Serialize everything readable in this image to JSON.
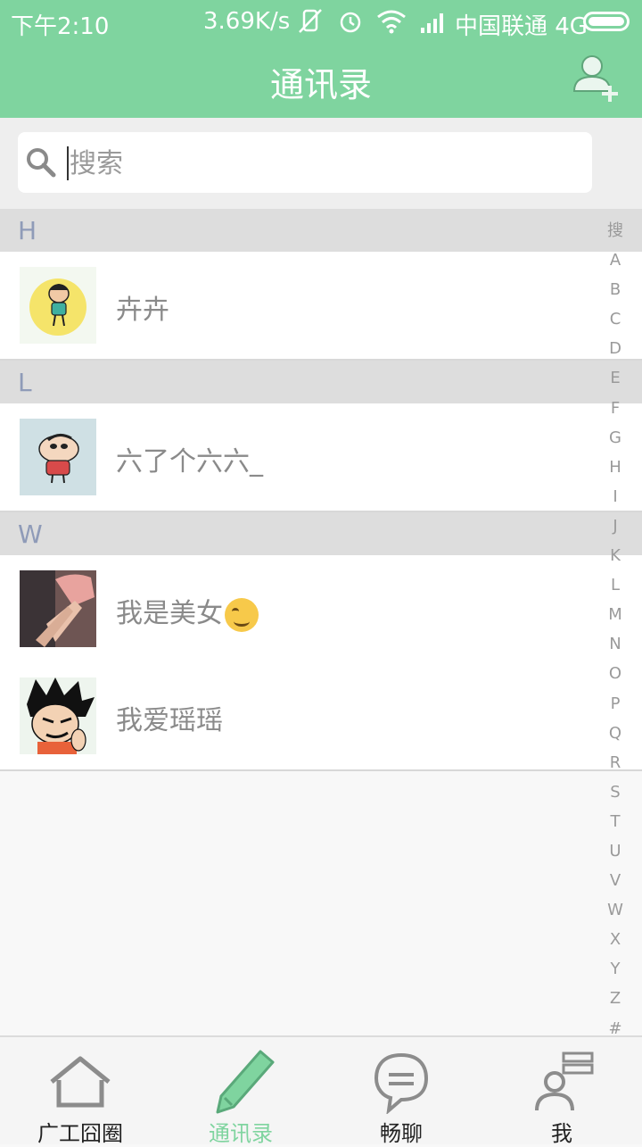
{
  "status_bar": {
    "time": "下午2:10",
    "speed": "3.69K/s",
    "carrier": "中国联通 4G",
    "icons": [
      "mute-icon",
      "alarm-icon",
      "wifi-icon",
      "signal-icon",
      "battery-icon"
    ]
  },
  "header": {
    "title": "通讯录",
    "add_contact_icon": "add-user-icon"
  },
  "search": {
    "placeholder": "搜索",
    "icon": "search-icon"
  },
  "sections": [
    {
      "letter": "H",
      "contacts": [
        {
          "name": "卉卉"
        }
      ]
    },
    {
      "letter": "L",
      "contacts": [
        {
          "name": "六了个六六_"
        }
      ]
    },
    {
      "letter": "W",
      "contacts": [
        {
          "name": "我是美女",
          "emoji": "smiling-face"
        },
        {
          "name": "我爱瑶瑶"
        }
      ]
    }
  ],
  "alphabet_index": [
    "搜",
    "A",
    "B",
    "C",
    "D",
    "E",
    "F",
    "G",
    "H",
    "I",
    "J",
    "K",
    "L",
    "M",
    "N",
    "O",
    "P",
    "Q",
    "R",
    "S",
    "T",
    "U",
    "V",
    "W",
    "X",
    "Y",
    "Z",
    "#"
  ],
  "tabs": [
    {
      "label": "广工囧圈",
      "icon": "home-icon",
      "active": false
    },
    {
      "label": "通讯录",
      "icon": "pencil-icon",
      "active": true
    },
    {
      "label": "畅聊",
      "icon": "chat-bubble-icon",
      "active": false
    },
    {
      "label": "我",
      "icon": "profile-icon",
      "active": false
    }
  ],
  "colors": {
    "accent": "#7fd49f",
    "section_bg": "#dddddd",
    "section_text": "#8f9bb8",
    "name_text": "#8a8a8a"
  }
}
